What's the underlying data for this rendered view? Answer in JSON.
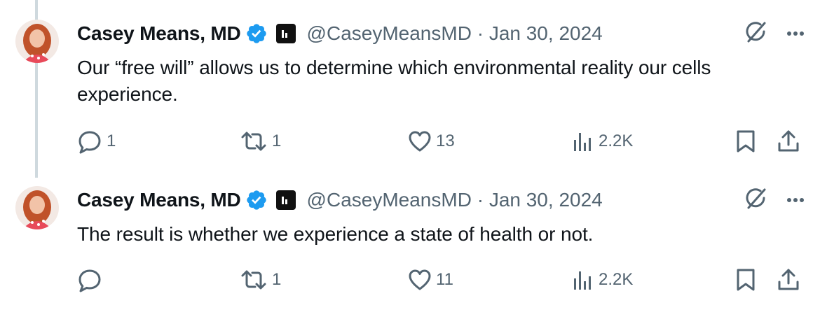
{
  "tweets": [
    {
      "author": "Casey Means, MD",
      "handle": "@CaseyMeansMD",
      "separator": "·",
      "date": "Jan 30, 2024",
      "text": "Our “free will” allows us to determine which environmental reality our cells experience.",
      "replies": "1",
      "retweets": "1",
      "likes": "13",
      "views": "2.2K"
    },
    {
      "author": "Casey Means, MD",
      "handle": "@CaseyMeansMD",
      "separator": "·",
      "date": "Jan 30, 2024",
      "text": "The result is whether we experience a state of health or not.",
      "replies": "",
      "retweets": "1",
      "likes": "11",
      "views": "2.2K"
    }
  ],
  "colors": {
    "text": "#0f1419",
    "secondary": "#536471",
    "verified": "#1d9bf0",
    "thread_line": "#cfd9de"
  },
  "icons": [
    "verified-badge-icon",
    "affiliation-badge-icon",
    "grok-icon",
    "more-icon",
    "reply-icon",
    "retweet-icon",
    "like-icon",
    "views-icon",
    "bookmark-icon",
    "share-icon"
  ]
}
